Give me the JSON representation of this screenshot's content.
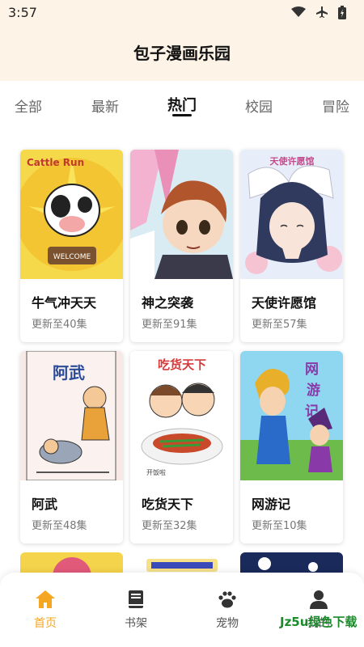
{
  "status": {
    "time": "3:57"
  },
  "app": {
    "title": "包子漫画乐园"
  },
  "tabs": [
    {
      "label": "全部",
      "active": false
    },
    {
      "label": "最新",
      "active": false
    },
    {
      "label": "热门",
      "active": true
    },
    {
      "label": "校园",
      "active": false
    },
    {
      "label": "冒险",
      "active": false
    }
  ],
  "comics": [
    {
      "title": "牛气冲天天",
      "subtitle": "更新至40集",
      "cover_text": "Cattle Run",
      "cover_sign": "WELCOME"
    },
    {
      "title": "神之突袭",
      "subtitle": "更新至91集"
    },
    {
      "title": "天使许愿馆",
      "subtitle": "更新至57集",
      "cover_text": "天使许愿馆"
    },
    {
      "title": "阿武",
      "subtitle": "更新至48集",
      "cover_text": "阿武"
    },
    {
      "title": "吃货天下",
      "subtitle": "更新至32集",
      "cover_text": "吃货天下",
      "cover_tag": "开饭啦"
    },
    {
      "title": "网游记",
      "subtitle": "更新至10集",
      "cover_text": "网游记"
    }
  ],
  "bottom_nav": [
    {
      "label": "首页",
      "icon": "home-icon",
      "active": true
    },
    {
      "label": "书架",
      "icon": "book-icon",
      "active": false
    },
    {
      "label": "宠物",
      "icon": "paw-icon",
      "active": false
    },
    {
      "label": "我的",
      "icon": "user-icon",
      "active": false
    }
  ],
  "watermark": "Jz5u绿色下载",
  "colors": {
    "accent": "#f5a623",
    "header_bg": "#fdf3e6",
    "active_text": "#111111"
  }
}
